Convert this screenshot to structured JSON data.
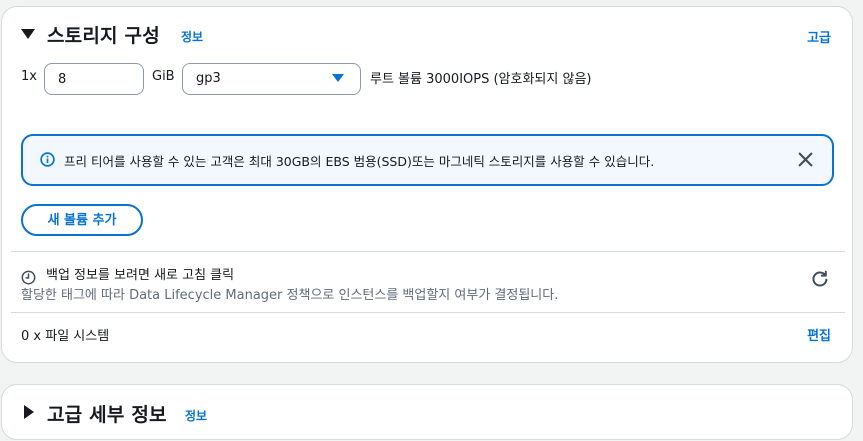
{
  "storage": {
    "title": "스토리지 구성",
    "info_link": "정보",
    "advanced_link": "고급",
    "volume": {
      "multiplier": "1x",
      "size_value": "8",
      "size_unit": "GiB",
      "type_value": "gp3",
      "description": "루트 볼륨  3000IOPS  (암호화되지 않음)"
    },
    "alert": {
      "icon": "info-circle-icon",
      "text": "프리 티어를 사용할 수 있는 고객은 최대 30GB의 EBS 범용(SSD)또는 마그네틱 스토리지를 사용할 수 있습니다."
    },
    "add_volume_button": "새 볼륨 추가",
    "backup": {
      "title": "백업 정보를 보려면 새로 고침 클릭",
      "description": "할당한 태그에 따라 Data Lifecycle Manager 정책으로 인스턴스를 백업할지 여부가 결정됩니다."
    },
    "filesystems": {
      "label": "0 x 파일 시스템",
      "edit_link": "편집"
    }
  },
  "advanced": {
    "title": "고급 세부 정보",
    "info_link": "정보"
  },
  "colors": {
    "link_blue": "#0972d3",
    "alert_background": "#f2f8fd",
    "border": "#d5dbdb",
    "muted_text": "#5f6b7a"
  }
}
